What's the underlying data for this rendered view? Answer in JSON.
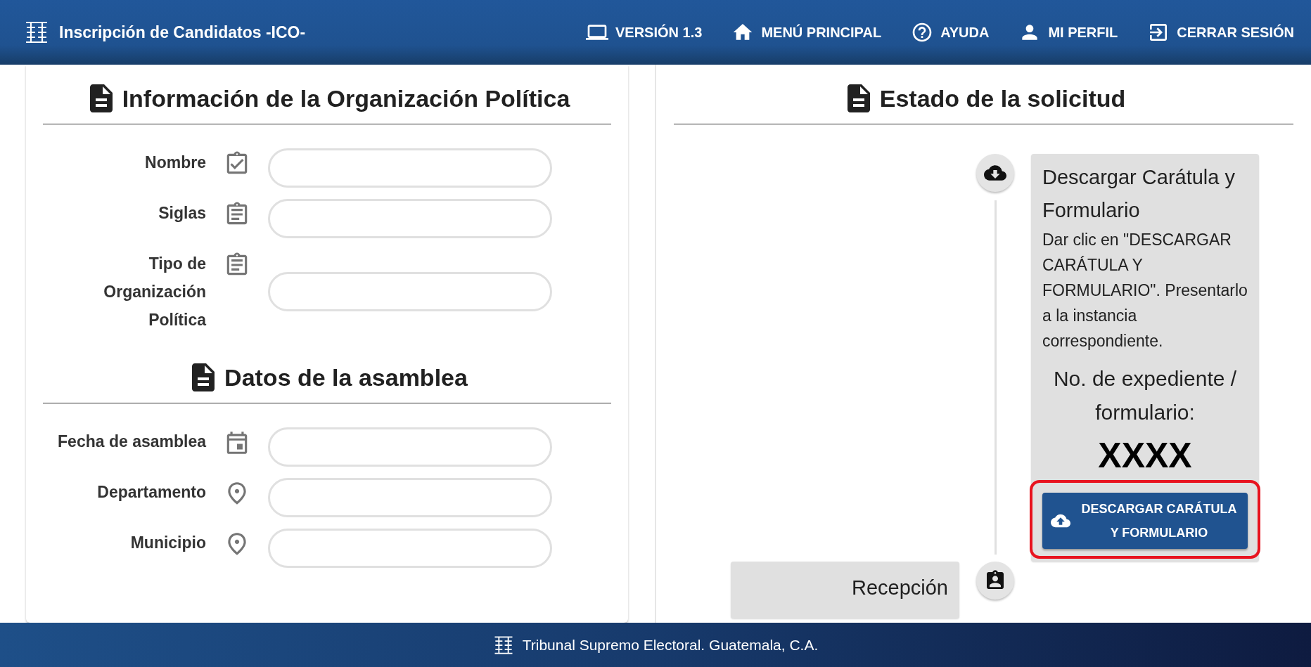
{
  "header": {
    "title": "Inscripción de Candidatos -ICO-",
    "nav": [
      {
        "kind": "laptop",
        "label": "VERSIÓN 1.3"
      },
      {
        "kind": "home",
        "label": "MENÚ PRINCIPAL"
      },
      {
        "kind": "help",
        "label": "AYUDA"
      },
      {
        "kind": "person",
        "label": "MI PERFIL"
      },
      {
        "kind": "logout",
        "label": "CERRAR SESIÓN"
      }
    ]
  },
  "sections": [
    {
      "title": "Información de la Organización Política",
      "fields": [
        {
          "label": "Nombre",
          "kind": "check"
        },
        {
          "label": "Siglas",
          "kind": "clipboard"
        },
        {
          "label": "Tipo de Organización Política",
          "kind": "clipboard"
        }
      ]
    },
    {
      "title": "Datos de la asamblea",
      "fields": [
        {
          "label": "Fecha de asamblea",
          "kind": "date"
        },
        {
          "label": "Departamento",
          "kind": "location"
        },
        {
          "label": "Municipio",
          "kind": "location"
        }
      ]
    }
  ],
  "status": {
    "title": "Estado de la solicitud",
    "steps": [
      {
        "kind": "download",
        "title": "Descargar Carátula y Formulario",
        "description": "Dar clic en \"DESCARGAR CARÁTULA Y FORMULARIO\". Presentarlo a la instancia correspondiente.",
        "number_label": "No. de expediente / formulario:",
        "number": "XXXX",
        "button": {
          "label": "DESCARGAR CARÁTULA Y FORMULARIO",
          "highlighted": true
        }
      },
      {
        "kind": "reception",
        "title": "Recepción"
      }
    ]
  },
  "footer": {
    "text": "Tribunal Supremo Electoral. Guatemala, C.A."
  }
}
